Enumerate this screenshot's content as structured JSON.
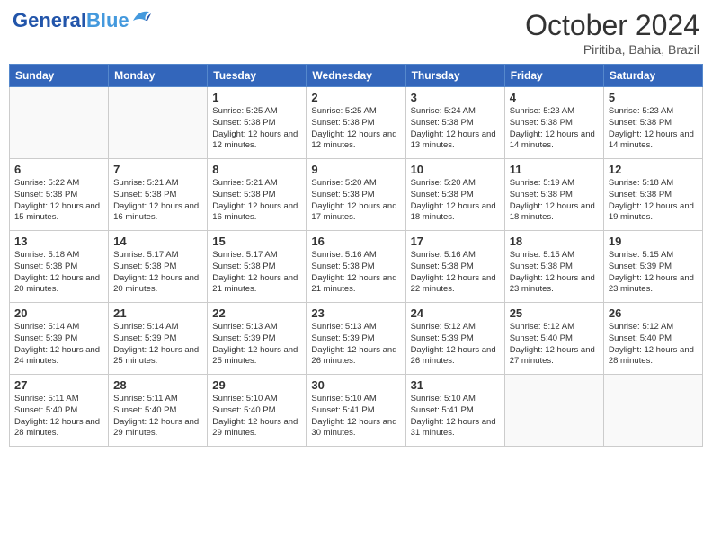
{
  "header": {
    "logo_general": "General",
    "logo_blue": "Blue",
    "month_year": "October 2024",
    "location": "Piritiba, Bahia, Brazil"
  },
  "days_of_week": [
    "Sunday",
    "Monday",
    "Tuesday",
    "Wednesday",
    "Thursday",
    "Friday",
    "Saturday"
  ],
  "weeks": [
    [
      {
        "day": "",
        "info": ""
      },
      {
        "day": "",
        "info": ""
      },
      {
        "day": "1",
        "info": "Sunrise: 5:25 AM\nSunset: 5:38 PM\nDaylight: 12 hours and 12 minutes."
      },
      {
        "day": "2",
        "info": "Sunrise: 5:25 AM\nSunset: 5:38 PM\nDaylight: 12 hours and 12 minutes."
      },
      {
        "day": "3",
        "info": "Sunrise: 5:24 AM\nSunset: 5:38 PM\nDaylight: 12 hours and 13 minutes."
      },
      {
        "day": "4",
        "info": "Sunrise: 5:23 AM\nSunset: 5:38 PM\nDaylight: 12 hours and 14 minutes."
      },
      {
        "day": "5",
        "info": "Sunrise: 5:23 AM\nSunset: 5:38 PM\nDaylight: 12 hours and 14 minutes."
      }
    ],
    [
      {
        "day": "6",
        "info": "Sunrise: 5:22 AM\nSunset: 5:38 PM\nDaylight: 12 hours and 15 minutes."
      },
      {
        "day": "7",
        "info": "Sunrise: 5:21 AM\nSunset: 5:38 PM\nDaylight: 12 hours and 16 minutes."
      },
      {
        "day": "8",
        "info": "Sunrise: 5:21 AM\nSunset: 5:38 PM\nDaylight: 12 hours and 16 minutes."
      },
      {
        "day": "9",
        "info": "Sunrise: 5:20 AM\nSunset: 5:38 PM\nDaylight: 12 hours and 17 minutes."
      },
      {
        "day": "10",
        "info": "Sunrise: 5:20 AM\nSunset: 5:38 PM\nDaylight: 12 hours and 18 minutes."
      },
      {
        "day": "11",
        "info": "Sunrise: 5:19 AM\nSunset: 5:38 PM\nDaylight: 12 hours and 18 minutes."
      },
      {
        "day": "12",
        "info": "Sunrise: 5:18 AM\nSunset: 5:38 PM\nDaylight: 12 hours and 19 minutes."
      }
    ],
    [
      {
        "day": "13",
        "info": "Sunrise: 5:18 AM\nSunset: 5:38 PM\nDaylight: 12 hours and 20 minutes."
      },
      {
        "day": "14",
        "info": "Sunrise: 5:17 AM\nSunset: 5:38 PM\nDaylight: 12 hours and 20 minutes."
      },
      {
        "day": "15",
        "info": "Sunrise: 5:17 AM\nSunset: 5:38 PM\nDaylight: 12 hours and 21 minutes."
      },
      {
        "day": "16",
        "info": "Sunrise: 5:16 AM\nSunset: 5:38 PM\nDaylight: 12 hours and 21 minutes."
      },
      {
        "day": "17",
        "info": "Sunrise: 5:16 AM\nSunset: 5:38 PM\nDaylight: 12 hours and 22 minutes."
      },
      {
        "day": "18",
        "info": "Sunrise: 5:15 AM\nSunset: 5:38 PM\nDaylight: 12 hours and 23 minutes."
      },
      {
        "day": "19",
        "info": "Sunrise: 5:15 AM\nSunset: 5:39 PM\nDaylight: 12 hours and 23 minutes."
      }
    ],
    [
      {
        "day": "20",
        "info": "Sunrise: 5:14 AM\nSunset: 5:39 PM\nDaylight: 12 hours and 24 minutes."
      },
      {
        "day": "21",
        "info": "Sunrise: 5:14 AM\nSunset: 5:39 PM\nDaylight: 12 hours and 25 minutes."
      },
      {
        "day": "22",
        "info": "Sunrise: 5:13 AM\nSunset: 5:39 PM\nDaylight: 12 hours and 25 minutes."
      },
      {
        "day": "23",
        "info": "Sunrise: 5:13 AM\nSunset: 5:39 PM\nDaylight: 12 hours and 26 minutes."
      },
      {
        "day": "24",
        "info": "Sunrise: 5:12 AM\nSunset: 5:39 PM\nDaylight: 12 hours and 26 minutes."
      },
      {
        "day": "25",
        "info": "Sunrise: 5:12 AM\nSunset: 5:40 PM\nDaylight: 12 hours and 27 minutes."
      },
      {
        "day": "26",
        "info": "Sunrise: 5:12 AM\nSunset: 5:40 PM\nDaylight: 12 hours and 28 minutes."
      }
    ],
    [
      {
        "day": "27",
        "info": "Sunrise: 5:11 AM\nSunset: 5:40 PM\nDaylight: 12 hours and 28 minutes."
      },
      {
        "day": "28",
        "info": "Sunrise: 5:11 AM\nSunset: 5:40 PM\nDaylight: 12 hours and 29 minutes."
      },
      {
        "day": "29",
        "info": "Sunrise: 5:10 AM\nSunset: 5:40 PM\nDaylight: 12 hours and 29 minutes."
      },
      {
        "day": "30",
        "info": "Sunrise: 5:10 AM\nSunset: 5:41 PM\nDaylight: 12 hours and 30 minutes."
      },
      {
        "day": "31",
        "info": "Sunrise: 5:10 AM\nSunset: 5:41 PM\nDaylight: 12 hours and 31 minutes."
      },
      {
        "day": "",
        "info": ""
      },
      {
        "day": "",
        "info": ""
      }
    ]
  ]
}
